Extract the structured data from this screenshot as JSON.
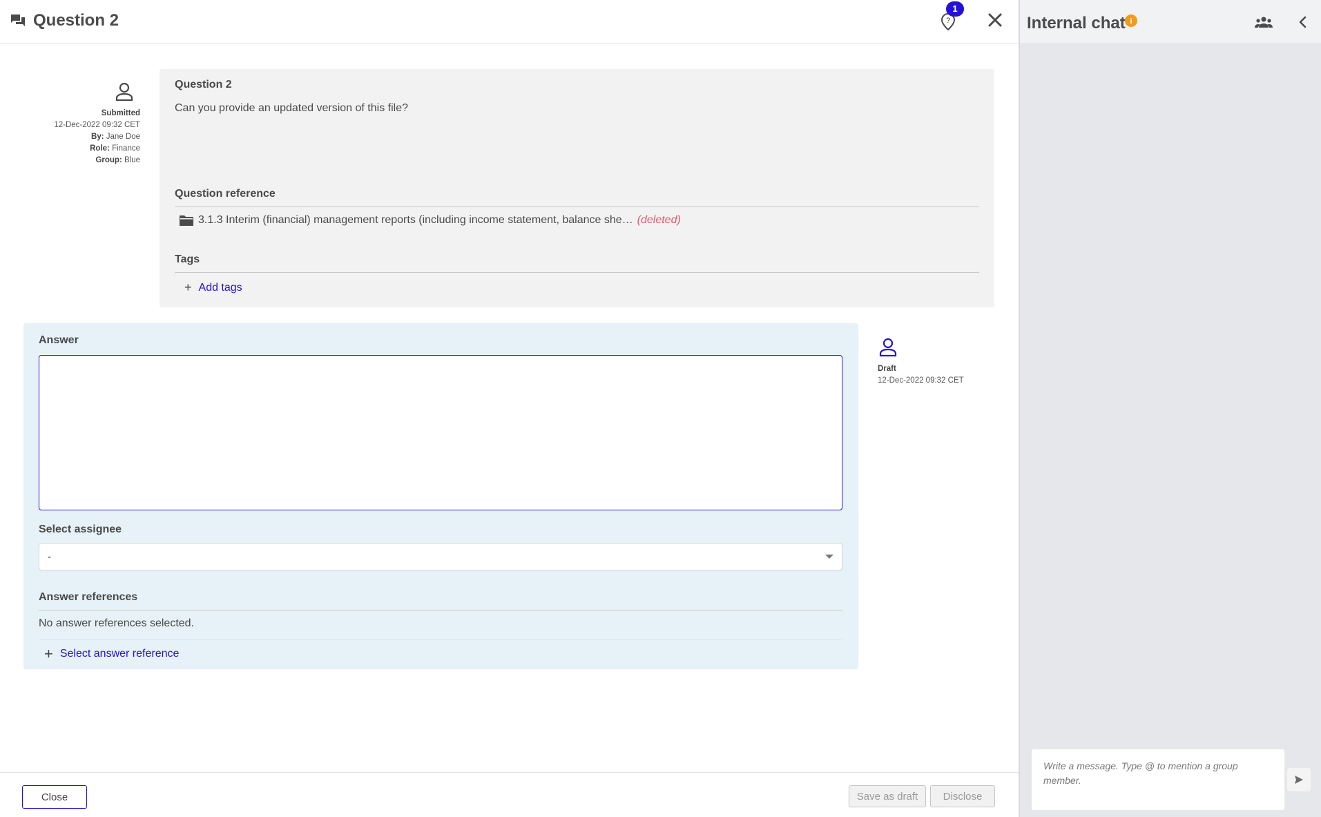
{
  "header": {
    "title": "Question 2",
    "help_badge_count": "1"
  },
  "question_meta": {
    "status": "Submitted",
    "timestamp": "12-Dec-2022 09:32 CET",
    "by_label": "By:",
    "by_value": "Jane Doe",
    "role_label": "Role:",
    "role_value": "Finance",
    "group_label": "Group:",
    "group_value": "Blue"
  },
  "question": {
    "title": "Question 2",
    "text": "Can you provide an updated version of this file?",
    "reference_label": "Question reference",
    "reference_text": "3.1.3 Interim (financial) management reports (including income statement, balance she…",
    "reference_status": "(deleted)",
    "tags_label": "Tags",
    "add_tags_label": "Add tags"
  },
  "answer": {
    "label": "Answer",
    "value": "",
    "assignee_label": "Select assignee",
    "assignee_value": "-",
    "references_label": "Answer references",
    "no_references_text": "No answer references selected.",
    "select_reference_label": "Select answer reference"
  },
  "draft_meta": {
    "status": "Draft",
    "timestamp": "12-Dec-2022 09:32 CET"
  },
  "footer": {
    "close_label": "Close",
    "save_draft_label": "Save as draft",
    "disclose_label": "Disclose"
  },
  "chat": {
    "title": "Internal chat",
    "info_icon_glyph": "i",
    "input_placeholder": "Write a message. Type @ to mention a group member."
  },
  "icons": {
    "header": "question-answer-icon",
    "help": "help-pin-icon",
    "close": "close-icon",
    "submitter": "person-icon",
    "folder": "folder-icon",
    "add": "plus-icon",
    "dropdown": "caret-down-icon",
    "members": "group-icon",
    "collapse": "chevron-left-icon",
    "send": "send-icon"
  },
  "colors": {
    "accent": "#2312d6",
    "deleted": "#e05a6b",
    "info": "#f29a1c",
    "answer_bg": "#e6f1f8",
    "question_bg": "#f2f2f2"
  }
}
